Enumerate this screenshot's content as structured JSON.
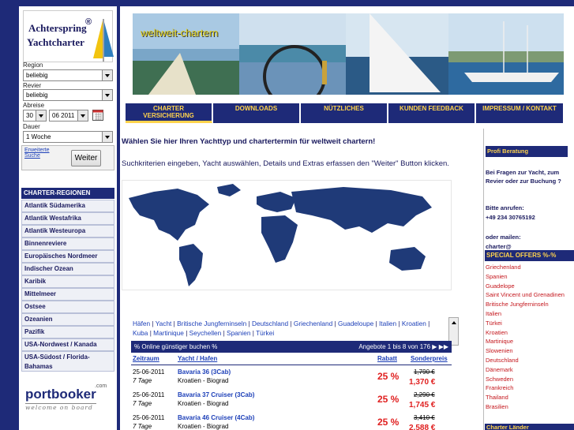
{
  "logo": {
    "line1": "Achterspring",
    "line2": "Yachtcharter",
    "reg": "®"
  },
  "form": {
    "region_label": "Region",
    "region_value": "beliebig",
    "revier_label": "Revier",
    "revier_value": "beliebig",
    "abreise_label": "Abreise",
    "day_value": "30",
    "month_value": "06 2011",
    "dauer_label": "Dauer",
    "dauer_value": "1 Woche",
    "extended_search": [
      "Erweiterte",
      "Suche"
    ],
    "weiter": "Weiter"
  },
  "regions": {
    "title": "CHARTER-REGIONEN",
    "items": [
      "Atlantik Südamerika",
      "Atlantik Westafrika",
      "Atlantik Westeuropa",
      "Binnenreviere",
      "Europäisches Nordmeer",
      "Indischer Ozean",
      "Karibik",
      "Mittelmeer",
      "Ostsee",
      "Ozeanien",
      "Pazifik",
      "USA-Nordwest / Kanada",
      "USA-Südost / Florida-Bahamas"
    ]
  },
  "portbooker": {
    "name": "portbooker",
    "com": ".com",
    "tagline": "welcome on board"
  },
  "header": {
    "overlay": "weltweit-chartern"
  },
  "nav": [
    {
      "label": "CHARTER",
      "label2": "VERSICHERUNG"
    },
    {
      "label": "DOWNLOADS"
    },
    {
      "label": "NÜTZLICHES"
    },
    {
      "label": "KUNDEN FEEDBACK"
    },
    {
      "label": "IMPRESSUM / KONTAKT"
    }
  ],
  "main": {
    "heading": "Wählen Sie hier Ihren Yachttyp und chartertermin für weltweit chartern!",
    "sub": "Suchkriterien eingeben, Yacht auswählen, Details und Extras erfassen den \"Weiter\" Button klicken.",
    "destinations": [
      "Häfen",
      "Yacht",
      "Britische Jungferninseln",
      "Deutschland",
      "Griechenland",
      "Guadeloupe",
      "Italien",
      "Kroatien",
      "Kuba",
      "Martinique",
      "Seychellen",
      "Spanien",
      "Türkei"
    ]
  },
  "table": {
    "title": "% Online günstiger buchen %",
    "paging": "Angebote 1 bis 8 von 176",
    "cols": [
      "Zeitraum",
      "Yacht / Hafen",
      "Rabatt",
      "Sonderpreis"
    ],
    "rows": [
      {
        "date": "25-06-2011",
        "days": "7 Tage",
        "yacht": "Bavaria 36 (3Cab)",
        "port": "Kroatien - Biograd",
        "rabatt": "25 %",
        "old": "1,790 €",
        "price": "1,370 €"
      },
      {
        "date": "25-06-2011",
        "days": "7 Tage",
        "yacht": "Bavaria 37 Cruiser (3Cab)",
        "port": "Kroatien - Biograd",
        "rabatt": "25 %",
        "old": "2,290 €",
        "price": "1,745 €"
      },
      {
        "date": "25-06-2011",
        "days": "7 Tage",
        "yacht": "Bavaria 46 Cruiser (4Cab)",
        "port": "Kroatien - Biograd",
        "rabatt": "25 %",
        "old": "3,410 €",
        "price": "2,588 €"
      }
    ]
  },
  "sidebar": {
    "profi": "Profi Beratung",
    "question": "Bei Fragen zur Yacht, zum Revier oder zur Buchung ?",
    "call_label": "Bitte anrufen:",
    "phone": "+49 234 30765192",
    "mail_label": "oder mailen:",
    "mail": "charter@",
    "offers_title": "SPECIAL OFFERS %-%",
    "offers": [
      "Griechenland",
      "Spanien",
      "Guadelope",
      "Saint Vincent und Grenadinen",
      "Britische Jungferninseln",
      "Italien",
      "Türkei",
      "Kroatien",
      "Martinique",
      "Slowenien",
      "Deutschland",
      "Dänemark",
      "Schweden",
      "Frankreich",
      "Thailand",
      "Brasilien"
    ],
    "laender": "Charter Länder"
  },
  "colors": {
    "navy": "#1e2a78",
    "gold": "#ffd34d",
    "red": "#e02020"
  }
}
